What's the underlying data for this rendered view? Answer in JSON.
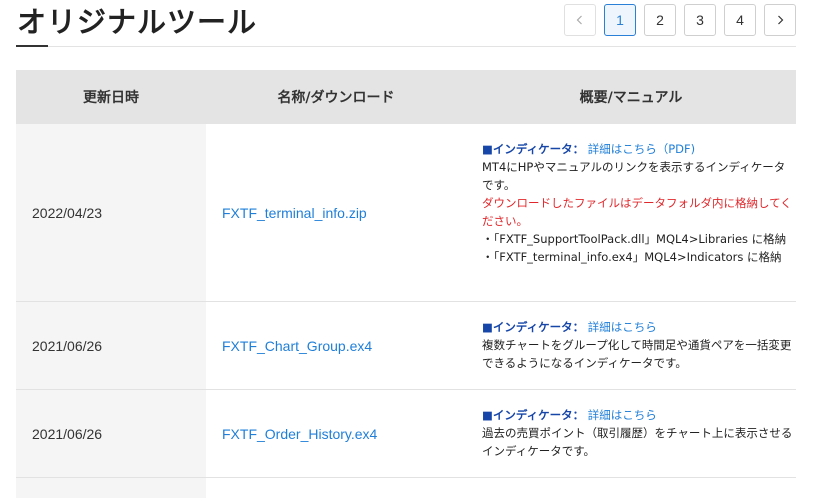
{
  "header": {
    "title": "オリジナルツール"
  },
  "pagination": {
    "prev_icon": "chevron-left-icon",
    "next_icon": "chevron-right-icon",
    "pages": [
      "1",
      "2",
      "3",
      "4"
    ],
    "current": "1"
  },
  "table": {
    "columns": [
      "更新日時",
      "名称/ダウンロード",
      "概要/マニュアル"
    ],
    "rows": [
      {
        "date": "2022/04/23",
        "file": "FXTF_terminal_info.zip",
        "square": "■",
        "type": "インディケータ：",
        "link": "詳細はこちら（PDF)",
        "text": "MT4にHPやマニュアルのリンクを表示するインディケータです。",
        "warning": "ダウンロードしたファイルはデータフォルダ内に格納してください。",
        "notes": [
          "・「FXTF_SupportToolPack.dll」MQL4>Libraries に格納",
          "・「FXTF_terminal_info.ex4」MQL4>Indicators に格納"
        ]
      },
      {
        "date": "2021/06/26",
        "file": "FXTF_Chart_Group.ex4",
        "square": "■",
        "type": "インディケータ：",
        "link": "詳細はこちら",
        "text": "複数チャートをグループ化して時間足や通貨ペアを一括変更できるようになるインディケータです。"
      },
      {
        "date": "2021/06/26",
        "file": "FXTF_Order_History.ex4",
        "square": "■",
        "type": "インディケータ：",
        "link": "詳細はこちら",
        "text": "過去の売買ポイント（取引履歴）をチャート上に表示させるインディケータです。"
      }
    ]
  },
  "colors": {
    "link": "#1f7fd8",
    "indicator_label": "#1646a8",
    "warning": "#e0282c",
    "header_bg": "#e4e4e4",
    "date_bg": "#f5f5f5"
  }
}
